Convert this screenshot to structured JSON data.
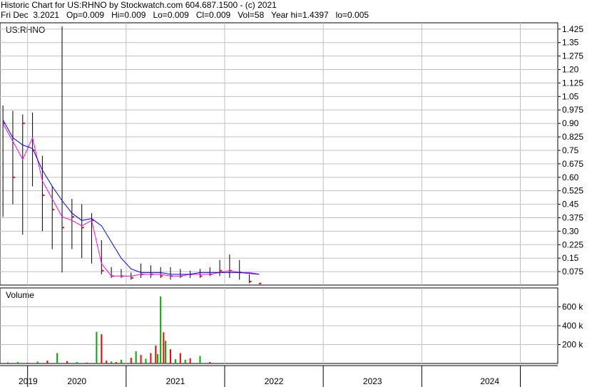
{
  "header": {
    "title_line": "Historic Chart for US:RHNO by Stockwatch.com 604.687.1500 - (c) 2021",
    "quote_line": "Fri Dec  3.2021   Op=0.009   Hi=0.009   Lo=0.009   Cl=0.009   Vol=58   Year hi=1.4397   lo=0.005"
  },
  "colors": {
    "price_bar": "#000000",
    "close_tick": "#ff0000",
    "ma_short": "#ff00ff",
    "ma_long": "#0000ff",
    "volume_up": "#00aa00",
    "volume_down": "#ff0000",
    "grid": "#c0c0c0"
  },
  "chart_data": [
    {
      "type": "line",
      "title": "US:RHNO",
      "ylim": [
        0.0,
        1.46
      ],
      "y_ticks": [
        "1.425",
        "1.35",
        "1.275",
        "1.20",
        "1.125",
        "1.05",
        "0.975",
        "0.90",
        "0.825",
        "0.75",
        "0.675",
        "0.60",
        "0.525",
        "0.45",
        "0.375",
        "0.30",
        "0.225",
        "0.15",
        "0.075"
      ],
      "x_labels": [
        "2019",
        "2020",
        "2021",
        "2022",
        "2023",
        "2024"
      ],
      "x": [
        2018.75,
        2018.85,
        2018.95,
        2019.05,
        2019.15,
        2019.25,
        2019.35,
        2019.45,
        2019.55,
        2019.65,
        2019.75,
        2019.85,
        2019.95,
        2020.05,
        2020.15,
        2020.25,
        2020.35,
        2020.45,
        2020.55,
        2020.65,
        2020.75,
        2020.85,
        2020.95,
        2021.05,
        2021.15,
        2021.25,
        2021.35
      ],
      "series": [
        {
          "key": "high",
          "values": [
            1.0,
            0.97,
            0.95,
            0.96,
            0.72,
            0.55,
            1.44,
            0.48,
            0.45,
            0.4,
            0.25,
            0.1,
            0.09,
            0.07,
            0.12,
            0.11,
            0.1,
            0.1,
            0.09,
            0.08,
            0.09,
            0.1,
            0.14,
            0.17,
            0.14,
            0.06,
            0.01
          ]
        },
        {
          "key": "low",
          "values": [
            0.38,
            0.45,
            0.28,
            0.55,
            0.3,
            0.2,
            0.07,
            0.2,
            0.15,
            0.12,
            0.06,
            0.04,
            0.04,
            0.03,
            0.04,
            0.04,
            0.04,
            0.03,
            0.04,
            0.04,
            0.04,
            0.05,
            0.05,
            0.04,
            0.03,
            0.01,
            0.005
          ]
        },
        {
          "key": "close",
          "values": [
            0.9,
            0.6,
            0.9,
            0.75,
            0.5,
            0.42,
            0.32,
            0.38,
            0.32,
            0.36,
            0.08,
            0.05,
            0.05,
            0.04,
            0.06,
            0.06,
            0.05,
            0.05,
            0.05,
            0.06,
            0.05,
            0.06,
            0.08,
            0.08,
            0.07,
            0.02,
            0.009
          ]
        },
        {
          "key": "ma_short",
          "values": [
            0.9,
            0.8,
            0.7,
            0.82,
            0.58,
            0.48,
            0.38,
            0.36,
            0.33,
            0.36,
            0.12,
            0.05,
            0.05,
            0.05,
            0.06,
            0.06,
            0.06,
            0.05,
            0.05,
            0.06,
            0.06,
            0.06,
            0.07,
            0.08,
            0.07,
            0.07,
            0.06
          ]
        },
        {
          "key": "ma_long",
          "values": [
            0.92,
            0.82,
            0.78,
            0.76,
            0.64,
            0.55,
            0.47,
            0.4,
            0.36,
            0.37,
            0.33,
            0.24,
            0.15,
            0.09,
            0.07,
            0.07,
            0.07,
            0.06,
            0.06,
            0.06,
            0.07,
            0.07,
            0.07,
            0.07,
            0.07,
            0.065,
            0.06
          ]
        }
      ]
    },
    {
      "type": "bar",
      "title": "Volume",
      "ylim": [
        0,
        800000
      ],
      "y_ticks": [
        "600 k",
        "400 k",
        "200 k"
      ],
      "x": [
        2018.8,
        2018.9,
        2019.0,
        2019.1,
        2019.2,
        2019.3,
        2019.4,
        2019.5,
        2019.6,
        2019.7,
        2019.75,
        2019.8,
        2019.85,
        2019.9,
        2019.95,
        2020.05,
        2020.1,
        2020.15,
        2020.2,
        2020.25,
        2020.3,
        2020.32,
        2020.35,
        2020.38,
        2020.4,
        2020.45,
        2020.5,
        2020.55,
        2020.6,
        2020.65,
        2020.75,
        2020.85
      ],
      "values": [
        10000,
        15000,
        8000,
        20000,
        30000,
        110000,
        25000,
        15000,
        10000,
        335000,
        310000,
        30000,
        20000,
        15000,
        40000,
        60000,
        130000,
        90000,
        50000,
        110000,
        190000,
        100000,
        710000,
        330000,
        240000,
        150000,
        45000,
        110000,
        40000,
        55000,
        80000,
        15000
      ],
      "up": [
        false,
        true,
        false,
        true,
        false,
        true,
        false,
        true,
        false,
        true,
        false,
        false,
        true,
        false,
        true,
        false,
        true,
        false,
        true,
        false,
        false,
        true,
        true,
        false,
        true,
        false,
        true,
        false,
        true,
        false,
        true,
        false
      ]
    }
  ]
}
